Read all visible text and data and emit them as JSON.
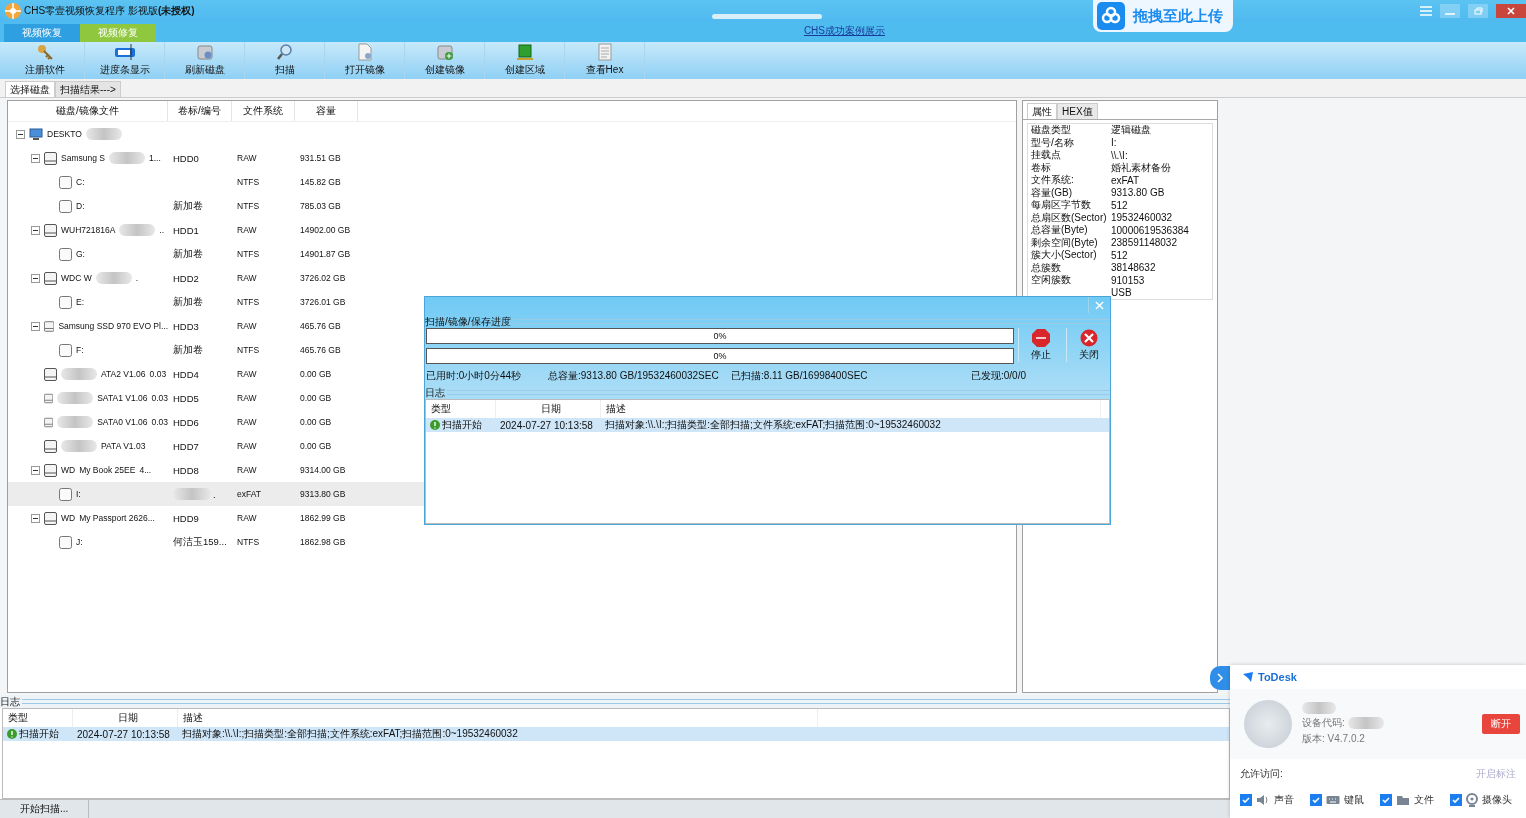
{
  "window": {
    "title": "CHS零壹视频恢复程序 影视版**(未授权)**"
  },
  "mode_tabs": [
    {
      "label": "视频恢复",
      "selected": true
    },
    {
      "label": "视频修复",
      "selected": false
    }
  ],
  "case_link": "CHS成功案例展示",
  "upload_badge": {
    "label": "拖拽至此上传"
  },
  "toolbar": [
    {
      "label": "注册软件"
    },
    {
      "label": "进度条显示"
    },
    {
      "label": "刷新磁盘"
    },
    {
      "label": "扫描"
    },
    {
      "label": "打开镜像"
    },
    {
      "label": "创建镜像"
    },
    {
      "label": "创建区域"
    },
    {
      "label": "查看Hex"
    }
  ],
  "view_tabs": [
    {
      "label": "选择磁盘",
      "selected": true
    },
    {
      "label": "扫描结果--->",
      "selected": false
    }
  ],
  "disk_tree": {
    "columns": [
      "磁盘/镜像文件",
      "卷标/编号",
      "文件系统",
      "容量"
    ],
    "root": {
      "kind": "computer",
      "name": [
        {
          "kind": "text",
          "text": "DESKTO"
        },
        {
          "kind": "blur"
        }
      ],
      "selected": false,
      "children": [
        {
          "kind": "disk",
          "name": [
            {
              "kind": "text",
              "text": "Samsung S"
            },
            {
              "kind": "blur"
            },
            {
              "kind": "text",
              "text": "1..."
            }
          ],
          "volume": "HDD0",
          "fs": "RAW",
          "size": "931.51 GB",
          "selected": false,
          "children": [
            {
              "kind": "partition",
              "name": [
                {
                  "kind": "text",
                  "text": "C:"
                }
              ],
              "fs": "NTFS",
              "size": "145.82 GB",
              "selected": false
            },
            {
              "kind": "partition",
              "name": [
                {
                  "kind": "text",
                  "text": "D:"
                }
              ],
              "volume": "新加卷",
              "fs": "NTFS",
              "size": "785.03 GB",
              "selected": false
            }
          ]
        },
        {
          "kind": "disk",
          "name": [
            {
              "kind": "text",
              "text": "WUH721816A"
            },
            {
              "kind": "blur"
            },
            {
              "kind": "text",
              "text": ".."
            }
          ],
          "volume": "HDD1",
          "fs": "RAW",
          "size": "14902.00 GB",
          "selected": false,
          "children": [
            {
              "kind": "partition",
              "name": [
                {
                  "kind": "text",
                  "text": "G:"
                }
              ],
              "volume": "新加卷",
              "fs": "NTFS",
              "size": "14901.87 GB",
              "selected": false
            }
          ]
        },
        {
          "kind": "disk",
          "name": [
            {
              "kind": "text",
              "text": "WDC W"
            },
            {
              "kind": "blur"
            },
            {
              "kind": "text",
              "text": "."
            }
          ],
          "volume": "HDD2",
          "fs": "RAW",
          "size": "3726.02 GB",
          "selected": false,
          "children": [
            {
              "kind": "partition",
              "name": [
                {
                  "kind": "text",
                  "text": "E:"
                }
              ],
              "volume": "新加卷",
              "fs": "NTFS",
              "size": "3726.01 GB",
              "selected": false
            }
          ]
        },
        {
          "kind": "disk",
          "name": [
            {
              "kind": "text",
              "text": "Samsung SSD 970 EVO Pl..."
            }
          ],
          "volume": "HDD3",
          "fs": "RAW",
          "size": "465.76 GB",
          "selected": false,
          "children": [
            {
              "kind": "partition",
              "name": [
                {
                  "kind": "text",
                  "text": "F:"
                }
              ],
              "volume": "新加卷",
              "fs": "NTFS",
              "size": "465.76 GB",
              "selected": false
            }
          ]
        },
        {
          "kind": "disk",
          "name": [
            {
              "kind": "blur"
            },
            {
              "kind": "text",
              "text": "ATA2 V1.06"
            },
            {
              "kind": "text",
              "text": "0.03"
            }
          ],
          "volume": "HDD4",
          "fs": "RAW",
          "size": "0.00 GB",
          "selected": false
        },
        {
          "kind": "disk",
          "name": [
            {
              "kind": "blur"
            },
            {
              "kind": "text",
              "text": "SATA1 V1.06"
            },
            {
              "kind": "text",
              "text": "0.03"
            }
          ],
          "volume": "HDD5",
          "fs": "RAW",
          "size": "0.00 GB",
          "selected": false
        },
        {
          "kind": "disk",
          "name": [
            {
              "kind": "blur"
            },
            {
              "kind": "text",
              "text": "SATA0 V1.06"
            },
            {
              "kind": "text",
              "text": "0.03"
            }
          ],
          "volume": "HDD6",
          "fs": "RAW",
          "size": "0.00 GB",
          "selected": false
        },
        {
          "kind": "disk",
          "name": [
            {
              "kind": "blur"
            },
            {
              "kind": "text",
              "text": "PATA V1.03"
            }
          ],
          "volume": "HDD7",
          "fs": "RAW",
          "size": "0.00 GB",
          "selected": false
        },
        {
          "kind": "disk",
          "name": [
            {
              "kind": "text",
              "text": "WD"
            },
            {
              "kind": "text",
              "text": "My Book 25EE"
            },
            {
              "kind": "text",
              "text": "4..."
            }
          ],
          "volume": "HDD8",
          "fs": "RAW",
          "size": "9314.00 GB",
          "selected": false,
          "children": [
            {
              "kind": "partition",
              "name": [
                {
                  "kind": "text",
                  "text": "I:"
                }
              ],
              "volume": ".",
              "volume_blur": true,
              "fs": "exFAT",
              "size": "9313.80 GB",
              "selected": true
            }
          ]
        },
        {
          "kind": "disk",
          "name": [
            {
              "kind": "text",
              "text": "WD"
            },
            {
              "kind": "text",
              "text": "My Passport 2626..."
            }
          ],
          "volume": "HDD9",
          "fs": "RAW",
          "size": "1862.99 GB",
          "selected": false,
          "children": [
            {
              "kind": "partition",
              "name": [
                {
                  "kind": "text",
                  "text": "J:"
                }
              ],
              "volume": "何洁玉159...",
              "fs": "NTFS",
              "size": "1862.98 GB",
              "selected": false
            }
          ]
        }
      ]
    }
  },
  "props_tabs": [
    {
      "label": "属性",
      "selected": true
    },
    {
      "label": "HEX值",
      "selected": false
    }
  ],
  "properties": [
    {
      "key": "磁盘类型",
      "value": "逻辑磁盘"
    },
    {
      "key": "型号/名称",
      "value": "I:"
    },
    {
      "key": "挂载点",
      "value": "\\\\.\\I:"
    },
    {
      "key": "卷标",
      "value": "婚礼素材备份"
    },
    {
      "key": "文件系统:",
      "value": "exFAT"
    },
    {
      "key": "容量(GB)",
      "value": "9313.80 GB"
    },
    {
      "key": "每扇区字节数",
      "value": "512"
    },
    {
      "key": "总扇区数(Sector)",
      "value": "19532460032"
    },
    {
      "key": "总容量(Byte)",
      "value": "10000619536384"
    },
    {
      "key": "剩余空间(Byte)",
      "value": "238591148032"
    },
    {
      "key": "簇大小(Sector)",
      "value": "512"
    },
    {
      "key": "总簇数",
      "value": "38148632"
    },
    {
      "key": "空闲簇数",
      "value": "910153"
    },
    {
      "value": "USB"
    }
  ],
  "dialog": {
    "section": "扫描/镜像/保存进度",
    "bars": [
      {
        "level": 0,
        "reading": "0%"
      },
      {
        "level": 0,
        "reading": "0%"
      }
    ],
    "buttons": [
      {
        "label": "停止"
      },
      {
        "label": "关闭"
      }
    ],
    "stats": [
      "已用时:0小时0分44秒",
      "总容量:9313.80 GB/19532460032SEC",
      "已扫描:8.11 GB/16998400SEC",
      "已发现:0/0/0"
    ],
    "log_title": "日志",
    "log": {
      "columns": [
        "类型",
        "日期",
        "描述"
      ],
      "rows": [
        {
          "type": "扫描开始",
          "date": "2024-07-27 10:13:58",
          "desc": "扫描对象:\\\\.\\I:;扫描类型:全部扫描;文件系统:exFAT;扫描范围:0~19532460032",
          "selected": true
        }
      ]
    }
  },
  "log_title": "日志",
  "log": {
    "columns": [
      "类型",
      "日期",
      "描述"
    ],
    "rows": [
      {
        "type": "扫描开始",
        "date": "2024-07-27 10:13:58",
        "desc": "扫描对象:\\\\.\\I:;扫描类型:全部扫描;文件系统:exFAT;扫描范围:0~19532460032",
        "selected": true
      }
    ]
  },
  "status": "开始扫描...",
  "todesk": {
    "title": "ToDesk",
    "device_label": "设备代码:",
    "version": "版本: V4.7.0.2",
    "disconnect": "断开",
    "allow_label": "允许访问:",
    "annotate": "开启标注",
    "permissions": [
      {
        "label": "声音",
        "checked": true
      },
      {
        "label": "键鼠",
        "checked": true
      },
      {
        "label": "文件",
        "checked": true
      },
      {
        "label": "摄像头",
        "checked": true
      }
    ]
  }
}
